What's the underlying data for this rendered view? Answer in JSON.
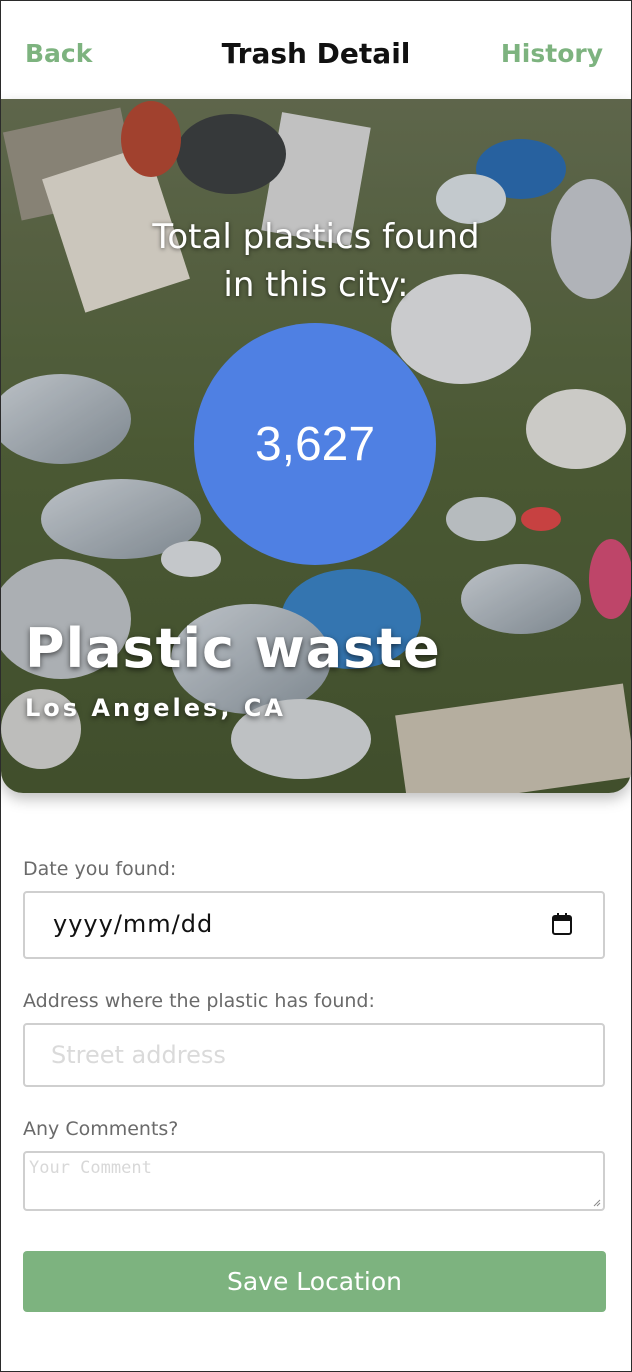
{
  "header": {
    "back_label": "Back",
    "title": "Trash Detail",
    "history_label": "History",
    "accent_color": "#7db37f"
  },
  "hero": {
    "caption_line1": "Total plastics found",
    "caption_line2": "in this city:",
    "count": "3,627",
    "count_circle_color": "#4f80e3",
    "title": "Plastic waste",
    "location": "Los Angeles, CA",
    "background": "photo of plastic bottles and bags littered on grass"
  },
  "form": {
    "date_label": "Date you found:",
    "date_value": "yyyy/mm/dd",
    "date_icon": "calendar-icon",
    "address_label": "Address where the plastic has found:",
    "address_placeholder": "Street address",
    "comments_label": "Any Comments?",
    "comments_placeholder": "Your Comment",
    "save_label": "Save Location",
    "save_color": "#7db37f"
  }
}
